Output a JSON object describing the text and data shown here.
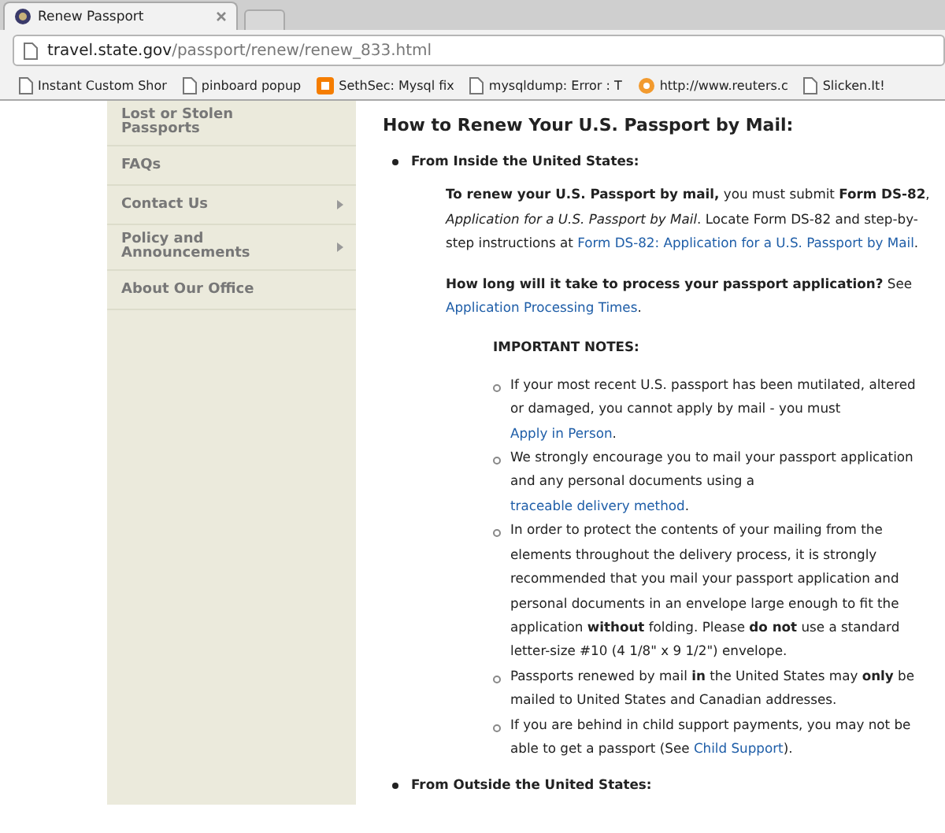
{
  "browser": {
    "tab_title": "Renew Passport",
    "url_host": "travel.state.gov",
    "url_path": "/passport/renew/renew_833.html",
    "bookmarks": [
      {
        "label": "Instant Custom Shor",
        "kind": "page"
      },
      {
        "label": "pinboard popup",
        "kind": "page"
      },
      {
        "label": "SethSec: Mysql fix",
        "kind": "blogger"
      },
      {
        "label": "mysqldump: Error : T",
        "kind": "page"
      },
      {
        "label": "http://www.reuters.c",
        "kind": "globe"
      },
      {
        "label": "Slicken.It!",
        "kind": "page"
      }
    ]
  },
  "sidebar": {
    "items": [
      {
        "label": "Lost or Stolen Passports",
        "has_submenu": false
      },
      {
        "label": "FAQs",
        "has_submenu": false
      },
      {
        "label": "Contact Us",
        "has_submenu": true
      },
      {
        "label": "Policy and Announcements",
        "has_submenu": true
      },
      {
        "label": "About Our Office",
        "has_submenu": false
      }
    ]
  },
  "main": {
    "heading": "How to Renew Your U.S. Passport by Mail:",
    "sections": [
      {
        "title": "From Inside the United States:",
        "paragraphs": [
          [
            {
              "kind": "bold",
              "text": "To renew your U.S. Passport by mail,"
            },
            {
              "kind": "text",
              "text": " you must submit "
            },
            {
              "kind": "bold",
              "text": "Form DS-82"
            },
            {
              "kind": "text",
              "text": ", "
            },
            {
              "kind": "italic",
              "text": "Application for a U.S. Passport by Mail"
            },
            {
              "kind": "text",
              "text": ". Locate Form DS-82 and step-by-step instructions at "
            },
            {
              "kind": "link",
              "text": "Form DS-82: Application for a U.S. Passport by Mail"
            },
            {
              "kind": "text",
              "text": "."
            }
          ],
          [
            {
              "kind": "bold",
              "text": "How long will it take to process your passport application?"
            },
            {
              "kind": "text",
              "text": " See "
            },
            {
              "kind": "link",
              "text": "Application Processing Times"
            },
            {
              "kind": "text",
              "text": "."
            }
          ]
        ],
        "notes_title": "IMPORTANT NOTES:",
        "notes": [
          [
            {
              "kind": "text",
              "text": "If your most recent U.S. passport has been mutilated, altered or damaged, you cannot apply by mail - you must "
            },
            {
              "kind": "link",
              "text": "Apply in Person"
            },
            {
              "kind": "text",
              "text": "."
            }
          ],
          [
            {
              "kind": "text",
              "text": "We strongly encourage you to mail your passport application and any personal documents using a "
            },
            {
              "kind": "link",
              "text": "traceable delivery method"
            },
            {
              "kind": "text",
              "text": "."
            }
          ],
          [
            {
              "kind": "text",
              "text": "In order to protect the contents of your mailing from the elements throughout the delivery process, it is strongly recommended that you mail your passport application and personal documents in an envelope large enough to fit the application "
            },
            {
              "kind": "bold",
              "text": "without"
            },
            {
              "kind": "text",
              "text": " folding. Please "
            },
            {
              "kind": "bold",
              "text": "do not"
            },
            {
              "kind": "text",
              "text": " use a standard letter-size #10 (4 1/8\" x 9 1/2\") envelope."
            }
          ],
          [
            {
              "kind": "text",
              "text": "Passports renewed by mail "
            },
            {
              "kind": "bold",
              "text": "in"
            },
            {
              "kind": "text",
              "text": " the United States may "
            },
            {
              "kind": "bold",
              "text": "only"
            },
            {
              "kind": "text",
              "text": " be mailed to United States and Canadian addresses."
            }
          ],
          [
            {
              "kind": "text",
              "text": "If you are behind in child support payments, you may not be able to get a passport (See "
            },
            {
              "kind": "link",
              "text": "Child Support"
            },
            {
              "kind": "text",
              "text": ")."
            }
          ]
        ]
      },
      {
        "title": "From Outside the United States:"
      }
    ]
  }
}
